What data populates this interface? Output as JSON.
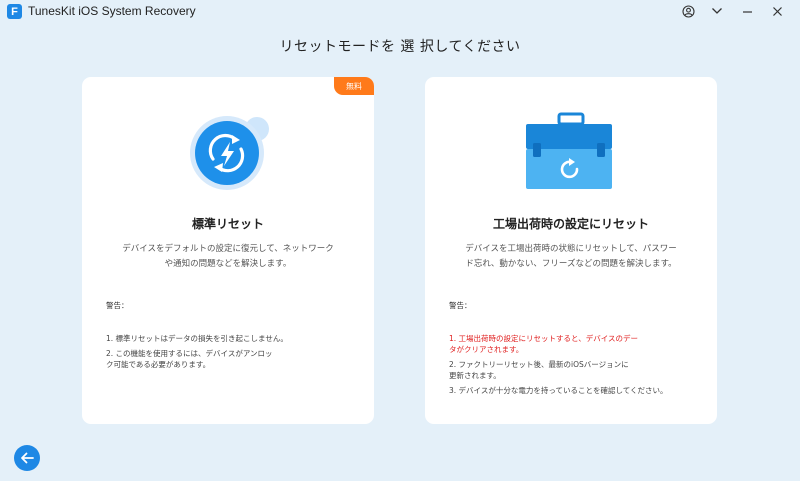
{
  "window": {
    "app_logo_letter": "F",
    "title": "TunesKit iOS System Recovery"
  },
  "header": {
    "title": "リセットモードを 選 択してください"
  },
  "cards": [
    {
      "badge": "無料",
      "title": "標準リセット",
      "description": "デバイスをデフォルトの設定に復元して、ネットワークや通知の問題などを解決します。",
      "warning_label": "警告：",
      "warnings": [
        "1. 標準リセットはデータの損失を引き起こしません。",
        "2. この機能を使用するには、デバイスがアンロック可能である必要があります。"
      ]
    },
    {
      "title": "工場出荷時の設定にリセット",
      "description": "デバイスを工場出荷時の状態にリセットして、パスワード忘れ、動かない、フリーズなどの問題を解決します。",
      "warning_label": "警告：",
      "warnings": [
        "1. 工場出荷時の設定にリセットすると、デバイスのデータがクリアされます。",
        "2. ファクトリーリセット後、最新のiOSバージョンに更新されます。",
        "3. デバイスが十分な電力を持っていることを確認してください。"
      ]
    }
  ],
  "colors": {
    "background": "#e4f0f9",
    "accent": "#1e88e5",
    "badge": "#ff7a1a",
    "warning_red": "#e02020"
  },
  "icons": [
    "account-icon",
    "chevron-down-icon",
    "minimize-icon",
    "close-icon",
    "quick-reset-icon",
    "toolbox-reset-icon",
    "back-arrow-icon"
  ]
}
